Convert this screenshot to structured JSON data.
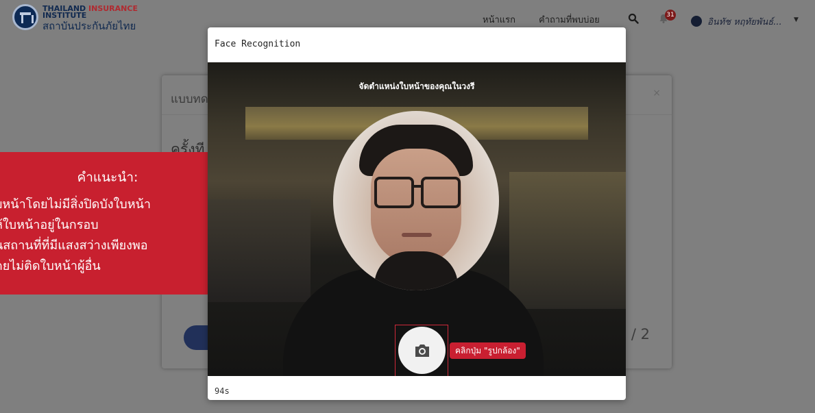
{
  "header": {
    "logo": {
      "line1_a": "THAILAND",
      "line1_b": "INSURANCE",
      "line2": "INSTITUTE",
      "line3": "สถาบันประกันภัยไทย"
    },
    "nav": [
      {
        "label": "หน้าแรก"
      },
      {
        "label": "คำถามที่พบบ่อย"
      }
    ],
    "notification_count": "31",
    "user_name": "อินทัช หฤทัยพันธ์..."
  },
  "background_card": {
    "title": "แบบทด",
    "question": "ครั้งที",
    "close_label": "×",
    "page_indicator": "/ 2"
  },
  "tips": {
    "title": "คำแนะนำ:",
    "lines": [
      "บหน้าโดยไม่มีสิ่งปิดบังใบหน้า",
      "ห้ใบหน้าอยู่ในกรอบ",
      "นสถานที่ที่มีแสงสว่างเพียงพอ",
      "ดยไม่ติดใบหน้าผู้อื่น"
    ]
  },
  "modal": {
    "title": "Face Recognition",
    "camera_hint": "จัดตำแหน่งใบหน้าของคุณในวงรี",
    "capture_tooltip": "คลิกปุ่ม \"รูปกล้อง\"",
    "timer": "94s"
  },
  "icons": {
    "search": "search-icon",
    "bell": "bell-icon",
    "user": "user-icon",
    "camera": "camera-icon",
    "caret": "chevron-down-icon"
  },
  "colors": {
    "brand_navy": "#10294f",
    "brand_red": "#c8202f",
    "tooltip_red": "#c91f31"
  }
}
